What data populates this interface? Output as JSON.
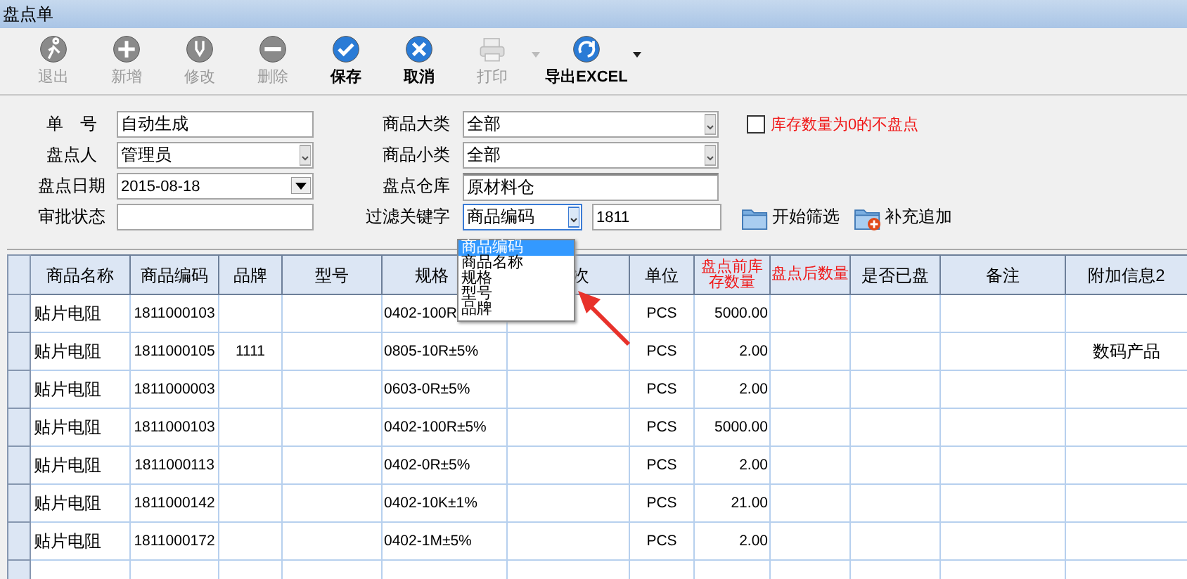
{
  "window": {
    "title": "盘点单"
  },
  "toolbar": [
    {
      "label": "退出",
      "kind": "exit",
      "disabled": true,
      "has_menu": false
    },
    {
      "label": "新增",
      "kind": "add",
      "disabled": true,
      "has_menu": false
    },
    {
      "label": "修改",
      "kind": "edit",
      "disabled": true,
      "has_menu": false
    },
    {
      "label": "删除",
      "kind": "delete",
      "disabled": true,
      "has_menu": false
    },
    {
      "label": "保存",
      "kind": "save",
      "disabled": false,
      "has_menu": false
    },
    {
      "label": "取消",
      "kind": "cancel",
      "disabled": false,
      "has_menu": false
    },
    {
      "label": "打印",
      "kind": "print",
      "disabled": true,
      "has_menu": true
    },
    {
      "label": "导出EXCEL",
      "kind": "export",
      "disabled": false,
      "has_menu": true
    }
  ],
  "form_left": [
    {
      "label": "单　号",
      "kind": "text",
      "value": "自动生成"
    },
    {
      "label": "盘点人",
      "kind": "combo",
      "value": "管理员"
    },
    {
      "label": "盘点日期",
      "kind": "date",
      "value": "2015-08-18"
    },
    {
      "label": "审批状态",
      "kind": "text"
    }
  ],
  "form_middle": [
    {
      "label": "商品大类",
      "kind": "combo",
      "value": "全部"
    },
    {
      "label": "商品小类",
      "kind": "combo",
      "value": "全部"
    },
    {
      "label": "盘点仓库",
      "kind": "text",
      "value": "原材料仓"
    },
    {
      "label": "过滤关键字",
      "kind": "filter",
      "value": "商品编码",
      "keyword": "1811"
    }
  ],
  "zero_stock_option": {
    "label": "库存数量为0的不盘点",
    "checked": false
  },
  "actions": [
    {
      "label": "开始筛选",
      "kind": "folder"
    },
    {
      "label": "补充追加",
      "kind": "folder-add"
    }
  ],
  "filter_dropdown": {
    "options": [
      {
        "label": "商品编码",
        "selected": true
      },
      {
        "label": "商品名称",
        "selected": false
      },
      {
        "label": "规格",
        "selected": false
      },
      {
        "label": "型号",
        "selected": false
      },
      {
        "label": "品牌",
        "selected": false
      }
    ]
  },
  "table": {
    "columns": [
      {
        "label": "商品名称",
        "required": false
      },
      {
        "label": "商品编码",
        "required": false
      },
      {
        "label": "品牌",
        "required": false
      },
      {
        "label": "型号",
        "required": false
      },
      {
        "label": "规格",
        "required": false
      },
      {
        "label": "次",
        "required": false
      },
      {
        "label": "单位",
        "required": false
      },
      {
        "label": "盘点前库存数量",
        "required": true
      },
      {
        "label": "盘点后数量",
        "required": true
      },
      {
        "label": "是否已盘",
        "required": false
      },
      {
        "label": "备注",
        "required": false
      },
      {
        "label": "附加信息2",
        "required": false
      }
    ],
    "rows": [
      {
        "name": "贴片电阻",
        "code": "1811000103",
        "spec": "0402-100R",
        "unit": "PCS",
        "qty_before": "5000.00"
      },
      {
        "name": "贴片电阻",
        "code": "1811000105",
        "brand": "1111",
        "spec": "0805-10R±5%",
        "unit": "PCS",
        "qty_before": "2.00",
        "extra2": "数码产品"
      },
      {
        "name": "贴片电阻",
        "code": "1811000003",
        "spec": "0603-0R±5%",
        "unit": "PCS",
        "qty_before": "2.00"
      },
      {
        "name": "贴片电阻",
        "code": "1811000103",
        "spec": "0402-100R±5%",
        "unit": "PCS",
        "qty_before": "5000.00"
      },
      {
        "name": "贴片电阻",
        "code": "1811000113",
        "spec": "0402-0R±5%",
        "unit": "PCS",
        "qty_before": "2.00"
      },
      {
        "name": "贴片电阻",
        "code": "1811000142",
        "spec": "0402-10K±1%",
        "unit": "PCS",
        "qty_before": "21.00"
      },
      {
        "name": "贴片电阻",
        "code": "1811000172",
        "spec": "0402-1M±5%",
        "unit": "PCS",
        "qty_before": "2.00"
      }
    ]
  }
}
